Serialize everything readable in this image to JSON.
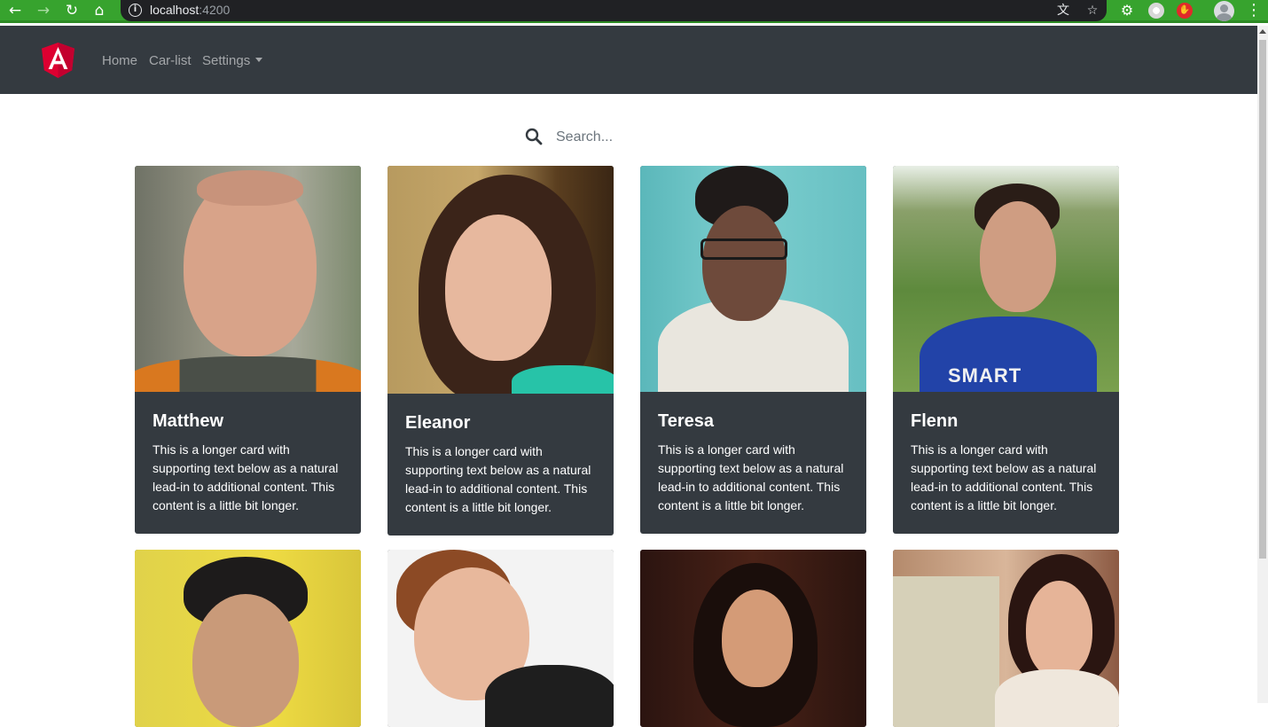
{
  "browser": {
    "url_host": "localhost",
    "url_port": ":4200"
  },
  "navbar": {
    "links": [
      "Home",
      "Car-list",
      "Settings"
    ]
  },
  "search": {
    "placeholder": "Search..."
  },
  "cards": [
    {
      "name": "Matthew",
      "text": "This is a longer card with supporting text below as a natural lead-in to additional content. This content is a little bit longer."
    },
    {
      "name": "Eleanor",
      "text": "This is a longer card with supporting text below as a natural lead-in to additional content. This content is a little bit longer."
    },
    {
      "name": "Teresa",
      "text": "This is a longer card with supporting text below as a natural lead-in to additional content. This content is a little bit longer."
    },
    {
      "name": "Flenn",
      "text": "This is a longer card with supporting text below as a natural lead-in to additional content. This content is a little bit longer."
    }
  ],
  "shirt_logo": "SMART",
  "colors": {
    "navbar": "#343a40",
    "card": "#343a40",
    "browser_frame": "#37a32e",
    "angular_red": "#dd0031"
  }
}
